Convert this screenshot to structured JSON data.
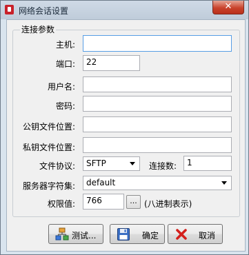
{
  "window": {
    "title": "网络会话设置",
    "close": "✕"
  },
  "group": {
    "title": "连接参数"
  },
  "fields": {
    "host": {
      "label": "主机:",
      "value": ""
    },
    "port": {
      "label": "端口:",
      "value": "22"
    },
    "username": {
      "label": "用户名:",
      "value": ""
    },
    "password": {
      "label": "密码:",
      "value": ""
    },
    "public_key": {
      "label": "公钥文件位置:",
      "value": ""
    },
    "private_key": {
      "label": "私钥文件位置:",
      "value": ""
    },
    "protocol": {
      "label": "文件协议:",
      "value": "SFTP"
    },
    "connections": {
      "label": "连接数:",
      "value": "1"
    },
    "charset": {
      "label": "服务器字符集:",
      "value": "default"
    },
    "permission": {
      "label": "权限值:",
      "value": "766",
      "browse": "...",
      "hint": "(八进制表示)"
    }
  },
  "buttons": {
    "test": "测试...",
    "ok": "确定",
    "cancel": "取消"
  },
  "icons": {
    "test": "network-test-icon",
    "ok": "save-disk-icon",
    "cancel": "red-x-icon"
  },
  "colors": {
    "close_button": "#c9432c",
    "focus_border": "#569de5",
    "title_bar": "#cfdae6"
  }
}
